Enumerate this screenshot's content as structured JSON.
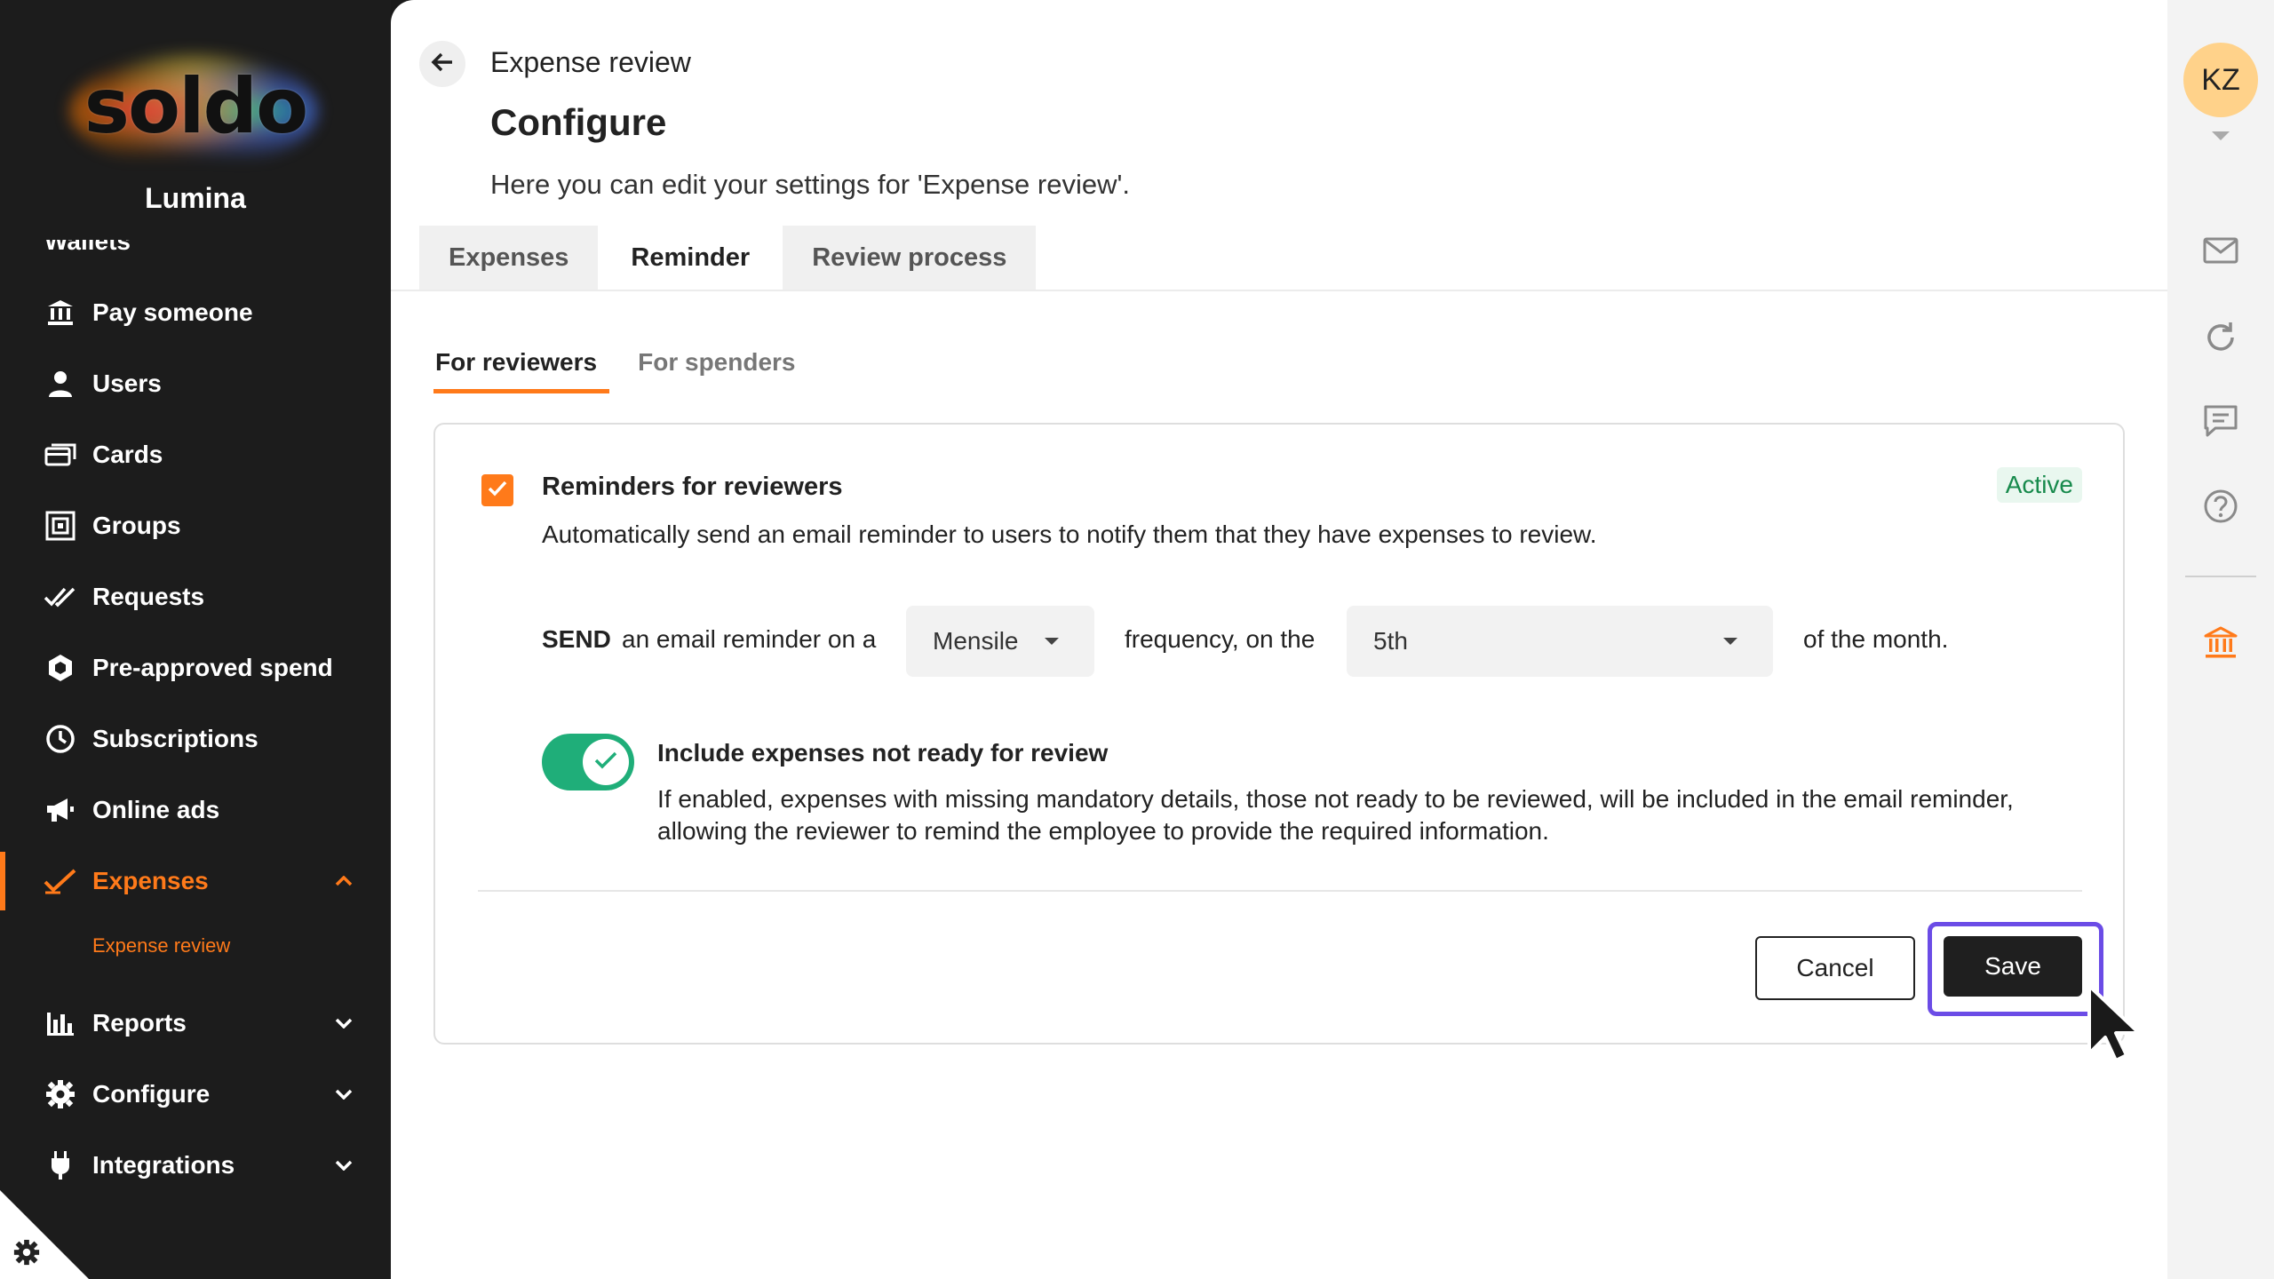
{
  "brand": {
    "logo_text": "soldo",
    "company": "Lumina"
  },
  "sidebar": {
    "partial_item": "Wallets",
    "items": [
      {
        "label": "Pay someone",
        "icon": "bank-transfer-icon"
      },
      {
        "label": "Users",
        "icon": "user-icon"
      },
      {
        "label": "Cards",
        "icon": "cards-icon"
      },
      {
        "label": "Groups",
        "icon": "groups-icon"
      },
      {
        "label": "Requests",
        "icon": "double-check-icon"
      },
      {
        "label": "Pre-approved spend",
        "icon": "hexagon-icon"
      },
      {
        "label": "Subscriptions",
        "icon": "clock-icon"
      },
      {
        "label": "Online ads",
        "icon": "megaphone-icon"
      },
      {
        "label": "Expenses",
        "icon": "check-icon",
        "active": true
      },
      {
        "label": "Reports",
        "icon": "bar-chart-icon"
      },
      {
        "label": "Configure",
        "icon": "gear-icon"
      },
      {
        "label": "Integrations",
        "icon": "plug-icon"
      }
    ],
    "sub_item": "Expense review"
  },
  "header": {
    "breadcrumb": "Expense review",
    "title": "Configure",
    "subtitle": "Here you can edit your settings for 'Expense review'."
  },
  "tabs": [
    {
      "label": "Expenses",
      "active": false
    },
    {
      "label": "Reminder",
      "active": true
    },
    {
      "label": "Review process",
      "active": false
    }
  ],
  "subtabs": [
    {
      "label": "For reviewers",
      "active": true
    },
    {
      "label": "For spenders",
      "active": false
    }
  ],
  "card": {
    "title": "Reminders for reviewers",
    "description": "Automatically send an email reminder to users to notify them that they have expenses to review.",
    "status": "Active",
    "checked": true,
    "send_row": {
      "send": "SEND",
      "text1": "an email reminder on a",
      "frequency_value": "Mensile",
      "text2": "frequency, on the",
      "day_value": "5th",
      "text3": "of the month."
    },
    "include": {
      "enabled": true,
      "title": "Include expenses not ready for review",
      "description": "If enabled, expenses with missing mandatory details, those not ready to be reviewed, will be included in the email reminder, allowing the reviewer to remind the employee to provide the required information."
    },
    "buttons": {
      "cancel": "Cancel",
      "save": "Save"
    }
  },
  "rail": {
    "avatar": "KZ"
  },
  "colors": {
    "accent": "#ff7a1a",
    "active_badge": "#178a4c",
    "toggle": "#1fae79",
    "focus": "#6b4ce6"
  }
}
